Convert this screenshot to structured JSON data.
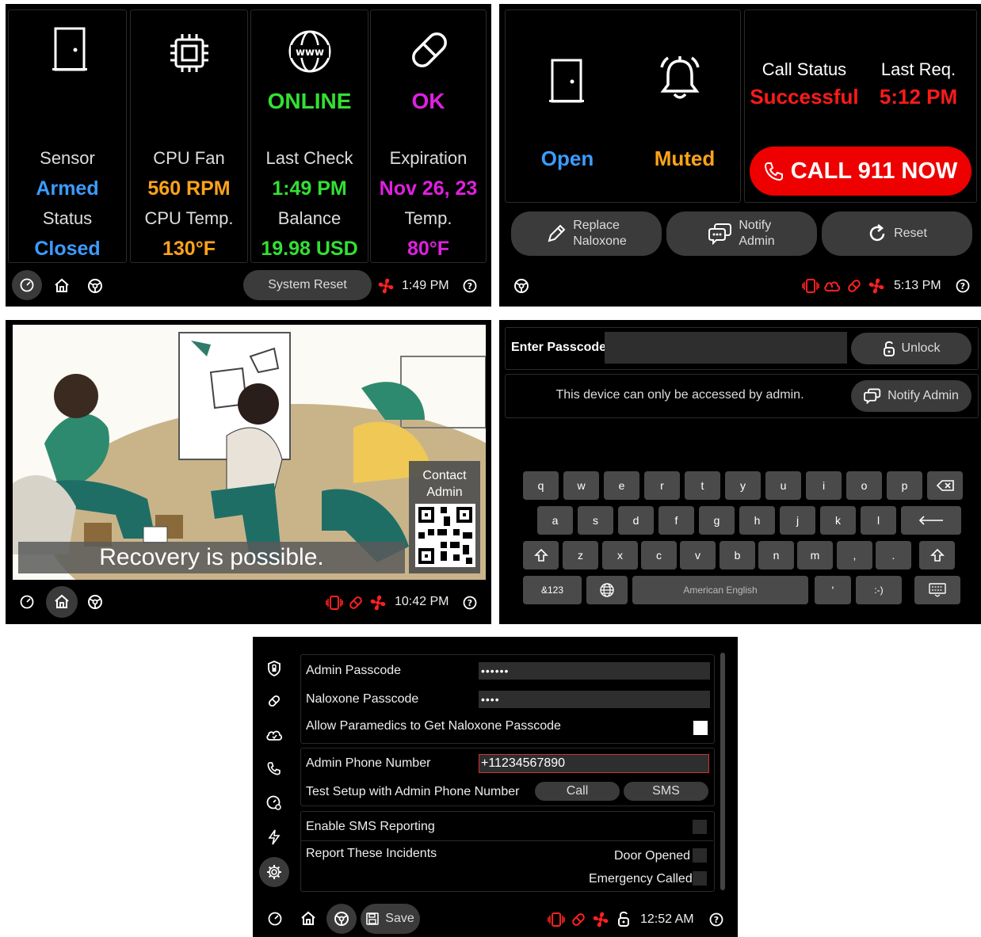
{
  "s1": {
    "cols": [
      {
        "top": "",
        "l1": "Sensor",
        "v1": "Armed",
        "l2": "Status",
        "v2": "Closed"
      },
      {
        "top": "",
        "l1": "CPU Fan",
        "v1": "560 RPM",
        "l2": "CPU Temp.",
        "v2": "130°F"
      },
      {
        "top": "ONLINE",
        "l1": "Last Check",
        "v1": "1:49 PM",
        "l2": "Balance",
        "v2": "19.98 USD"
      },
      {
        "top": "OK",
        "l1": "Expiration",
        "v1": "Nov 26, 23",
        "l2": "Temp.",
        "v2": "80°F"
      }
    ],
    "reset_label": "System Reset",
    "time": "1:49 PM"
  },
  "s2": {
    "door": "Open",
    "alarm": "Muted",
    "call_status_label": "Call Status",
    "call_status_value": "Successful",
    "last_req_label": "Last Req.",
    "last_req_value": "5:12 PM",
    "call_button": "CALL 911 NOW",
    "replace_l1": "Replace",
    "replace_l2": "Naloxone",
    "notify_l1": "Notify",
    "notify_l2": "Admin",
    "reset": "Reset",
    "time": "5:13 PM"
  },
  "s3": {
    "caption": "Recovery is possible.",
    "contact_l1": "Contact",
    "contact_l2": "Admin",
    "time": "10:42 PM"
  },
  "s4": {
    "enter_label": "Enter Passcode",
    "unlock": "Unlock",
    "message": "This device can only be accessed by admin.",
    "notify": "Notify Admin",
    "row1": [
      "q",
      "w",
      "e",
      "r",
      "t",
      "y",
      "u",
      "i",
      "o",
      "p"
    ],
    "row2": [
      "a",
      "s",
      "d",
      "f",
      "g",
      "h",
      "j",
      "k",
      "l"
    ],
    "row3": [
      "z",
      "x",
      "c",
      "v",
      "b",
      "n",
      "m",
      ",",
      "."
    ],
    "sym": "&123",
    "space": "American English",
    "apos": "'",
    "smiley": ":-)"
  },
  "s5": {
    "admin_pass_label": "Admin Passcode",
    "admin_pass_value": "••••••",
    "nalox_pass_label": "Naloxone Passcode",
    "nalox_pass_value": "••••",
    "allow_label": "Allow Paramedics to Get Naloxone Passcode",
    "phone_label": "Admin Phone Number",
    "phone_value": "+11234567890",
    "test_label": "Test Setup with Admin Phone Number",
    "call": "Call",
    "sms": "SMS",
    "enable_sms": "Enable SMS Reporting",
    "report_label": "Report These Incidents",
    "door_opened": "Door Opened",
    "emergency_called": "Emergency Called",
    "save": "Save",
    "time": "12:52 AM"
  },
  "colors": {
    "blue": "#3b9cff",
    "orange": "#ffa31a",
    "green": "#33e033",
    "magenta": "#e020e0",
    "red": "#ff1a1a",
    "callred": "#ee0000"
  }
}
